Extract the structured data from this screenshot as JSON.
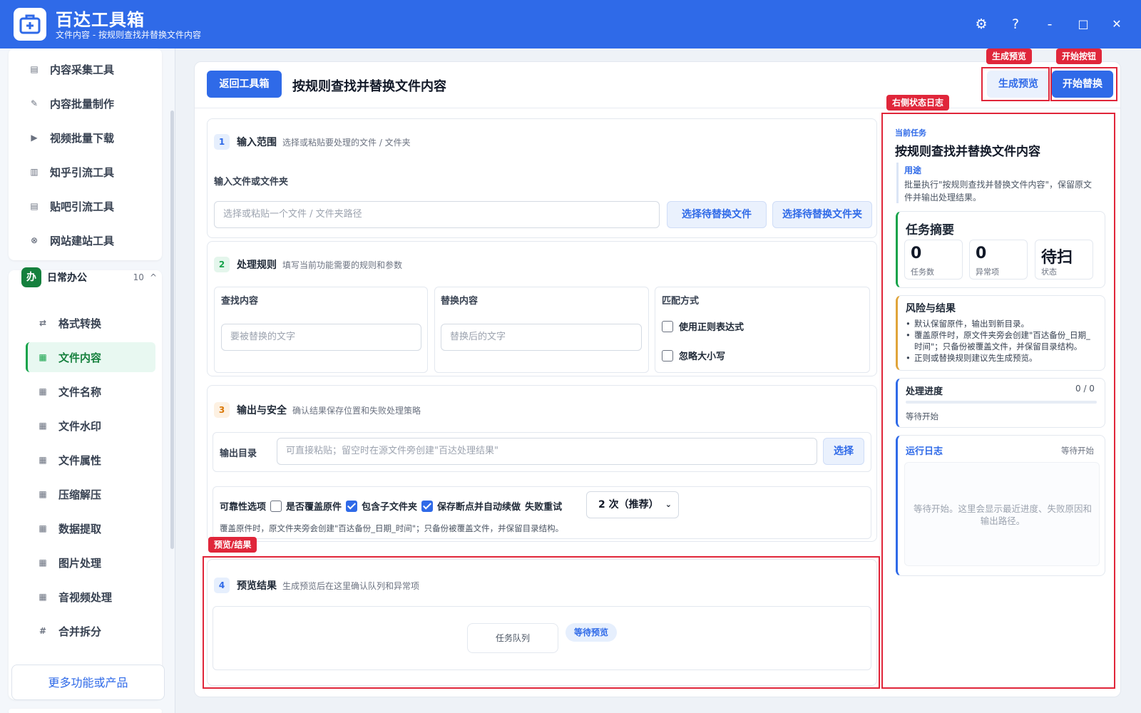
{
  "app": {
    "title": "百达工具箱",
    "subtitle": "文件内容 - 按规则查找并替换文件内容"
  },
  "window": {
    "settings": "⚙",
    "help": "?",
    "minimize": "-",
    "maximize": "□",
    "close": "✕"
  },
  "sidebar": {
    "top_items": [
      {
        "label": "内容采集工具",
        "icon": "▤"
      },
      {
        "label": "内容批量制作",
        "icon": "✎"
      },
      {
        "label": "视频批量下载",
        "icon": "▶"
      },
      {
        "label": "知乎引流工具",
        "icon": "▥"
      },
      {
        "label": "贴吧引流工具",
        "icon": "▤"
      },
      {
        "label": "网站建站工具",
        "icon": "⊗"
      }
    ],
    "group": {
      "badge": "办",
      "name": "日常办公",
      "count": "10",
      "toggle": "^"
    },
    "group_items": [
      {
        "label": "格式转换",
        "icon": "⇄"
      },
      {
        "label": "文件内容",
        "icon": "▦"
      },
      {
        "label": "文件名称",
        "icon": "▦"
      },
      {
        "label": "文件水印",
        "icon": "▦"
      },
      {
        "label": "文件属性",
        "icon": "▦"
      },
      {
        "label": "压缩解压",
        "icon": "▦"
      },
      {
        "label": "数据提取",
        "icon": "▦"
      },
      {
        "label": "图片处理",
        "icon": "▦"
      },
      {
        "label": "音视频处理",
        "icon": "▦"
      },
      {
        "label": "合并拆分",
        "icon": "#"
      }
    ],
    "more": "更多功能或产品"
  },
  "header": {
    "back": "返回工具箱",
    "title": "按规则查找并替换文件内容",
    "preview_btn": "生成预览",
    "start_btn": "开始替换"
  },
  "annotations": {
    "preview": "生成预览",
    "start": "开始按钮",
    "log": "右侧状态日志",
    "result": "预览/结果"
  },
  "sec1": {
    "num": "1",
    "name": "输入范围",
    "hint": "选择或粘贴要处理的文件 / 文件夹",
    "field_label": "输入文件或文件夹",
    "placeholder": "选择或粘贴一个文件 / 文件夹路径",
    "btn_file": "选择待替换文件",
    "btn_folder": "选择待替换文件夹"
  },
  "sec2": {
    "num": "2",
    "name": "处理规则",
    "hint": "填写当前功能需要的规则和参数",
    "find_label": "查找内容",
    "find_placeholder": "要被替换的文字",
    "replace_label": "替换内容",
    "replace_placeholder": "替换后的文字",
    "match_label": "匹配方式",
    "opt_regex": "使用正则表达式",
    "opt_case": "忽略大小写"
  },
  "sec3": {
    "num": "3",
    "name": "输出与安全",
    "hint": "确认结果保存位置和失败处理策略",
    "out_label": "输出目录",
    "out_placeholder": "可直接粘贴；留空时在源文件旁创建\"百达处理结果\"",
    "choose": "选择",
    "rel_label": "可靠性选项",
    "opt_overwrite": "是否覆盖原件",
    "opt_subfolders": "包含子文件夹",
    "opt_resume": "保存断点并自动续做",
    "retry_label": "失败重试",
    "retry_value": "2 次（推荐）",
    "note": "覆盖原件时，原文件夹旁会创建\"百达备份_日期_时间\"；只备份被覆盖文件，并保留目录结构。"
  },
  "sec4": {
    "num": "4",
    "name": "预览结果",
    "hint": "生成预览后在这里确认队列和异常项",
    "queue": "任务队列",
    "status": "等待预览"
  },
  "right": {
    "current_label": "当前任务",
    "current_title": "按规则查找并替换文件内容",
    "purpose_label": "用途",
    "purpose_text": "批量执行\"按规则查找并替换文件内容\"，保留原文件并输出处理结果。",
    "summary_title": "任务摘要",
    "stats": [
      {
        "value": "0",
        "label": "任务数"
      },
      {
        "value": "0",
        "label": "异常项"
      },
      {
        "value": "待扫",
        "label": "状态"
      }
    ],
    "risk_title": "风险与结果",
    "risks": [
      "默认保留原件，输出到新目录。",
      "覆盖原件时，原文件夹旁会创建\"百达备份_日期_时间\"；只备份被覆盖文件，并保留目录结构。",
      "正则或替换规则建议先生成预览。"
    ],
    "progress_title": "处理进度",
    "progress_value": "0 / 0",
    "progress_fraction": 0,
    "progress_text": "等待开始",
    "log_title": "运行日志",
    "log_status": "等待开始",
    "log_placeholder": "等待开始。这里会显示最近进度、失败原因和输出路径。"
  }
}
